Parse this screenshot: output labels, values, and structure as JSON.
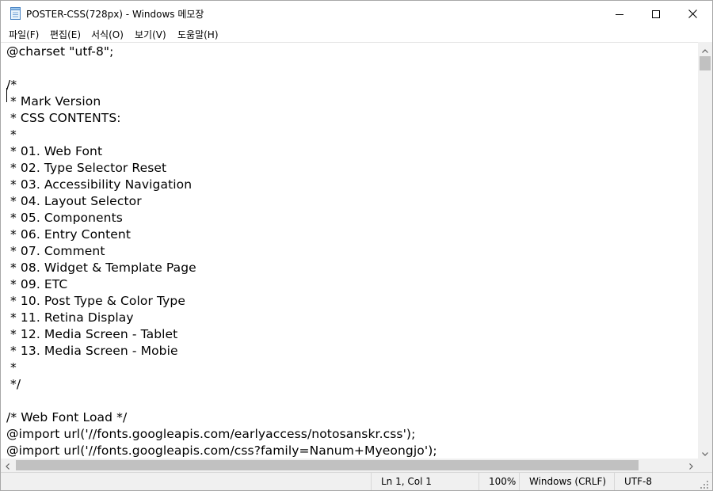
{
  "window": {
    "title": "POSTER-CSS(728px) - Windows 메모장",
    "icon": "notepad-icon",
    "controls": {
      "minimize_icon": "minimize-icon",
      "maximize_icon": "maximize-icon",
      "close_icon": "close-icon"
    }
  },
  "menu": {
    "items": [
      {
        "label": "파일(F)"
      },
      {
        "label": "편집(E)"
      },
      {
        "label": "서식(O)"
      },
      {
        "label": "보기(V)"
      },
      {
        "label": "도움말(H)"
      }
    ]
  },
  "editor": {
    "lines": [
      "@charset \"utf-8\";",
      "",
      "/*",
      " * Mark Version",
      " * CSS CONTENTS:",
      " *",
      " * 01. Web Font",
      " * 02. Type Selector Reset",
      " * 03. Accessibility Navigation",
      " * 04. Layout Selector",
      " * 05. Components",
      " * 06. Entry Content",
      " * 07. Comment",
      " * 08. Widget & Template Page",
      " * 09. ETC",
      " * 10. Post Type & Color Type",
      " * 11. Retina Display",
      " * 12. Media Screen - Tablet",
      " * 13. Media Screen - Mobie",
      " *",
      " */",
      "",
      "/* Web Font Load */",
      "@import url('//fonts.googleapis.com/earlyaccess/notosanskr.css');",
      "@import url('//fonts.googleapis.com/css?family=Nanum+Myeongjo');"
    ]
  },
  "statusbar": {
    "position": "Ln 1, Col 1",
    "zoom": "100%",
    "line_ending": "Windows (CRLF)",
    "encoding": "UTF-8"
  }
}
